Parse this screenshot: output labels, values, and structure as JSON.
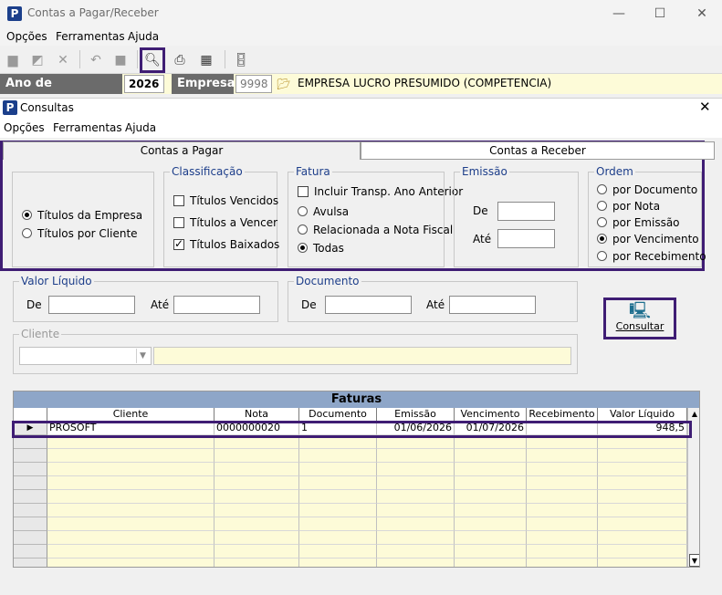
{
  "window": {
    "title": "Contas a Pagar/Receber",
    "minimize": "—",
    "maximize": "☐",
    "close": "✕"
  },
  "menu": [
    "Opções",
    "Ferramentas",
    "Ajuda"
  ],
  "infobar": {
    "ano_label": "Ano de Movimento",
    "ano_value": "2026",
    "empresa_label": "Empresa",
    "empresa_code": "9998",
    "empresa_name": "EMPRESA LUCRO PRESUMIDO (COMPETENCIA)"
  },
  "inner": {
    "title": "Consultas",
    "menu": [
      "Opções",
      "Ferramentas",
      "Ajuda"
    ],
    "tabs": [
      "Contas a Pagar",
      "Contas a Receber"
    ],
    "tipo": {
      "opt1": "Títulos da Empresa",
      "opt2": "Títulos por Cliente",
      "selected": 0
    },
    "classificacao": {
      "title": "Classificação",
      "items": [
        "Títulos Vencidos",
        "Títulos a Vencer",
        "Títulos Baixados"
      ],
      "checked": [
        false,
        false,
        true
      ]
    },
    "fatura": {
      "title": "Fatura",
      "check": "Incluir Transp. Ano Anterior",
      "radios": [
        "Avulsa",
        "Relacionada a Nota Fiscal",
        "Todas"
      ],
      "selected": 2
    },
    "emissao": {
      "title": "Emissão",
      "de": "De",
      "ate": "Até"
    },
    "ordem": {
      "title": "Ordem",
      "items": [
        "por Documento",
        "por Nota",
        "por Emissão",
        "por Vencimento",
        "por Recebimento"
      ],
      "selected": 3
    },
    "valor_liquido": {
      "title": "Valor Líquido",
      "de": "De",
      "ate": "Até"
    },
    "documento": {
      "title": "Documento",
      "de": "De",
      "ate": "Até"
    },
    "cliente": {
      "title": "Cliente"
    },
    "consultar": "Consultar"
  },
  "grid": {
    "title": "Faturas",
    "columns": [
      "Cliente",
      "Nota",
      "Documento",
      "Emissão",
      "Vencimento",
      "Recebimento",
      "Valor Líquido"
    ],
    "rows": [
      {
        "cliente": "PROSOFT",
        "nota": "0000000020",
        "documento": "1",
        "emissao": "01/06/2026",
        "vencimento": "01/07/2026",
        "recebimento": "",
        "valor": "948,5"
      }
    ]
  },
  "colors": {
    "accent_border": "#3f1d74",
    "grid_header": "#8ea6c8",
    "yellow": "#fdfbd8",
    "group_title": "#1d3e8a"
  }
}
